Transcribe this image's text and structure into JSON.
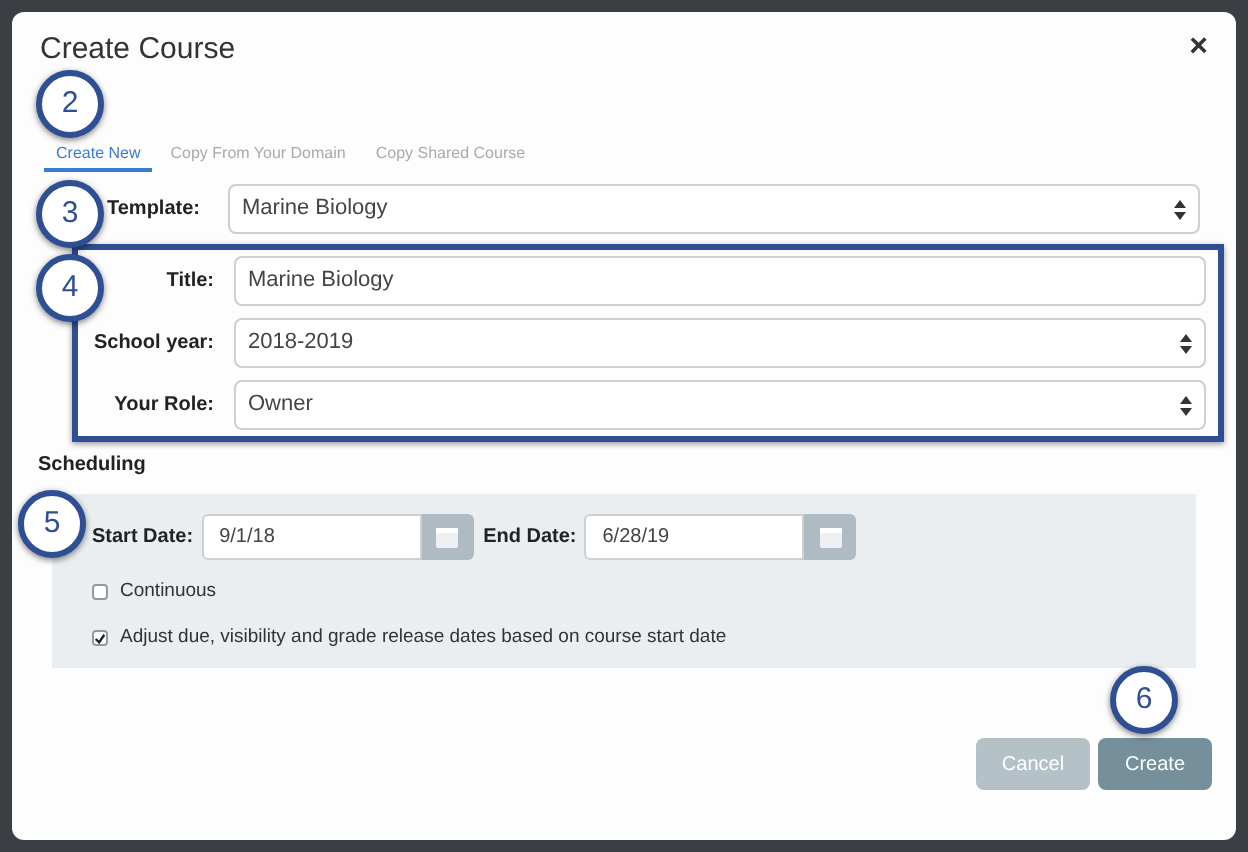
{
  "dialog": {
    "title": "Create Course",
    "close": "×"
  },
  "tabs": [
    {
      "label": "Create New",
      "selected": true
    },
    {
      "label": "Copy From Your Domain",
      "selected": false
    },
    {
      "label": "Copy Shared Course",
      "selected": false
    }
  ],
  "template": {
    "label": "Template:",
    "value": "Marine Biology",
    "kind": "select"
  },
  "fields": [
    {
      "label": "Title:",
      "value": "Marine Biology",
      "kind": "text"
    },
    {
      "label": "School year:",
      "value": "2018-2019",
      "kind": "select"
    },
    {
      "label": "Your Role:",
      "value": "Owner",
      "kind": "select"
    }
  ],
  "scheduling": {
    "heading": "Scheduling",
    "dates": [
      {
        "label": "Start Date:",
        "value": "9/1/18"
      },
      {
        "label": "End Date:",
        "value": "6/28/19"
      }
    ],
    "options": [
      {
        "label": "Continuous",
        "checked": false
      },
      {
        "label": "Adjust due, visibility and grade release dates based on course start date",
        "checked": true
      }
    ]
  },
  "buttons": [
    {
      "label": "Cancel",
      "disabled": true
    },
    {
      "label": "Create",
      "disabled": false
    }
  ],
  "callouts": [
    "2",
    "3",
    "4",
    "5",
    "6"
  ]
}
